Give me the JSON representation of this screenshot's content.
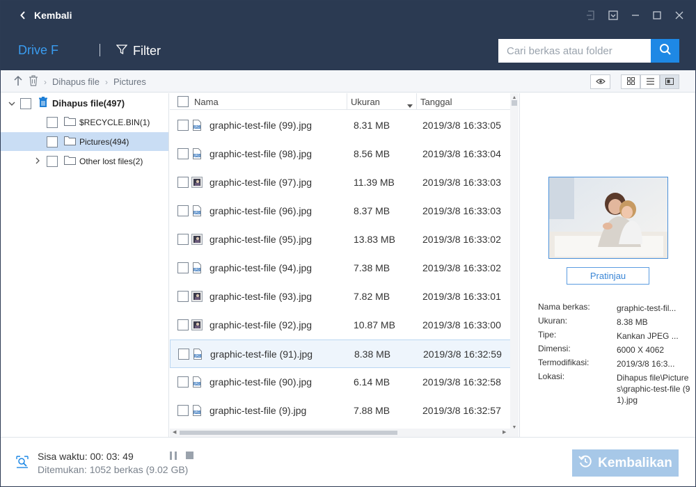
{
  "titlebar": {
    "back_label": "Kembali"
  },
  "toolbar": {
    "drive_label": "Drive F",
    "filter_label": "Filter",
    "search_placeholder": "Cari berkas atau folder"
  },
  "breadcrumb": [
    "Dihapus file",
    "Pictures"
  ],
  "tree": {
    "root": "Dihapus file(497)",
    "children": [
      {
        "label": "$RECYCLE.BIN(1)"
      },
      {
        "label": "Pictures(494)"
      },
      {
        "label": "Other lost files(2)"
      }
    ]
  },
  "list": {
    "columns": {
      "name": "Nama",
      "size": "Ukuran",
      "date": "Tanggal"
    },
    "rows": [
      {
        "name": "graphic-test-file (99).jpg",
        "size": "8.31 MB",
        "date": "2019/3/8 16:33:05",
        "icon": "jpg-icon"
      },
      {
        "name": "graphic-test-file (98).jpg",
        "size": "8.56 MB",
        "date": "2019/3/8 16:33:04",
        "icon": "jpg-icon"
      },
      {
        "name": "graphic-test-file (97).jpg",
        "size": "11.39 MB",
        "date": "2019/3/8 16:33:03",
        "icon": "photo-thumb-icon"
      },
      {
        "name": "graphic-test-file (96).jpg",
        "size": "8.37 MB",
        "date": "2019/3/8 16:33:03",
        "icon": "jpg-icon"
      },
      {
        "name": "graphic-test-file (95).jpg",
        "size": "13.83 MB",
        "date": "2019/3/8 16:33:02",
        "icon": "photo-thumb-icon"
      },
      {
        "name": "graphic-test-file (94).jpg",
        "size": "7.38 MB",
        "date": "2019/3/8 16:33:02",
        "icon": "jpg-icon"
      },
      {
        "name": "graphic-test-file (93).jpg",
        "size": "7.82 MB",
        "date": "2019/3/8 16:33:01",
        "icon": "photo-thumb-icon"
      },
      {
        "name": "graphic-test-file (92).jpg",
        "size": "10.87 MB",
        "date": "2019/3/8 16:33:00",
        "icon": "photo-thumb-icon"
      },
      {
        "name": "graphic-test-file (91).jpg",
        "size": "8.38 MB",
        "date": "2019/3/8 16:32:59",
        "icon": "jpg-icon"
      },
      {
        "name": "graphic-test-file (90).jpg",
        "size": "6.14 MB",
        "date": "2019/3/8 16:32:58",
        "icon": "jpg-icon"
      },
      {
        "name": "graphic-test-file (9).jpg",
        "size": "7.88 MB",
        "date": "2019/3/8 16:32:57",
        "icon": "jpg-icon"
      }
    ]
  },
  "preview": {
    "button_label": "Pratinjau",
    "props": [
      {
        "key": "Nama berkas:",
        "value": "graphic-test-fil..."
      },
      {
        "key": "Ukuran:",
        "value": "8.38 MB"
      },
      {
        "key": "Tipe:",
        "value": "Kankan JPEG ..."
      },
      {
        "key": "Dimensi:",
        "value": "6000 X 4062"
      },
      {
        "key": "Termodifikasi:",
        "value": "2019/3/8 16:3..."
      },
      {
        "key": "Lokasi:",
        "value": "Dihapus file\\Pictures\\graphic-test-file (91).jpg"
      }
    ]
  },
  "footer": {
    "time_left": "Sisa waktu: 00: 03: 49",
    "found": "Ditemukan: 1052 berkas (9.02 GB)",
    "recover_label": "Kembalikan"
  },
  "colors": {
    "header_bg": "#2b3a52",
    "accent": "#1e88e5",
    "selected_row": "#c9ddf4",
    "recover_btn": "#a7c8e8"
  }
}
